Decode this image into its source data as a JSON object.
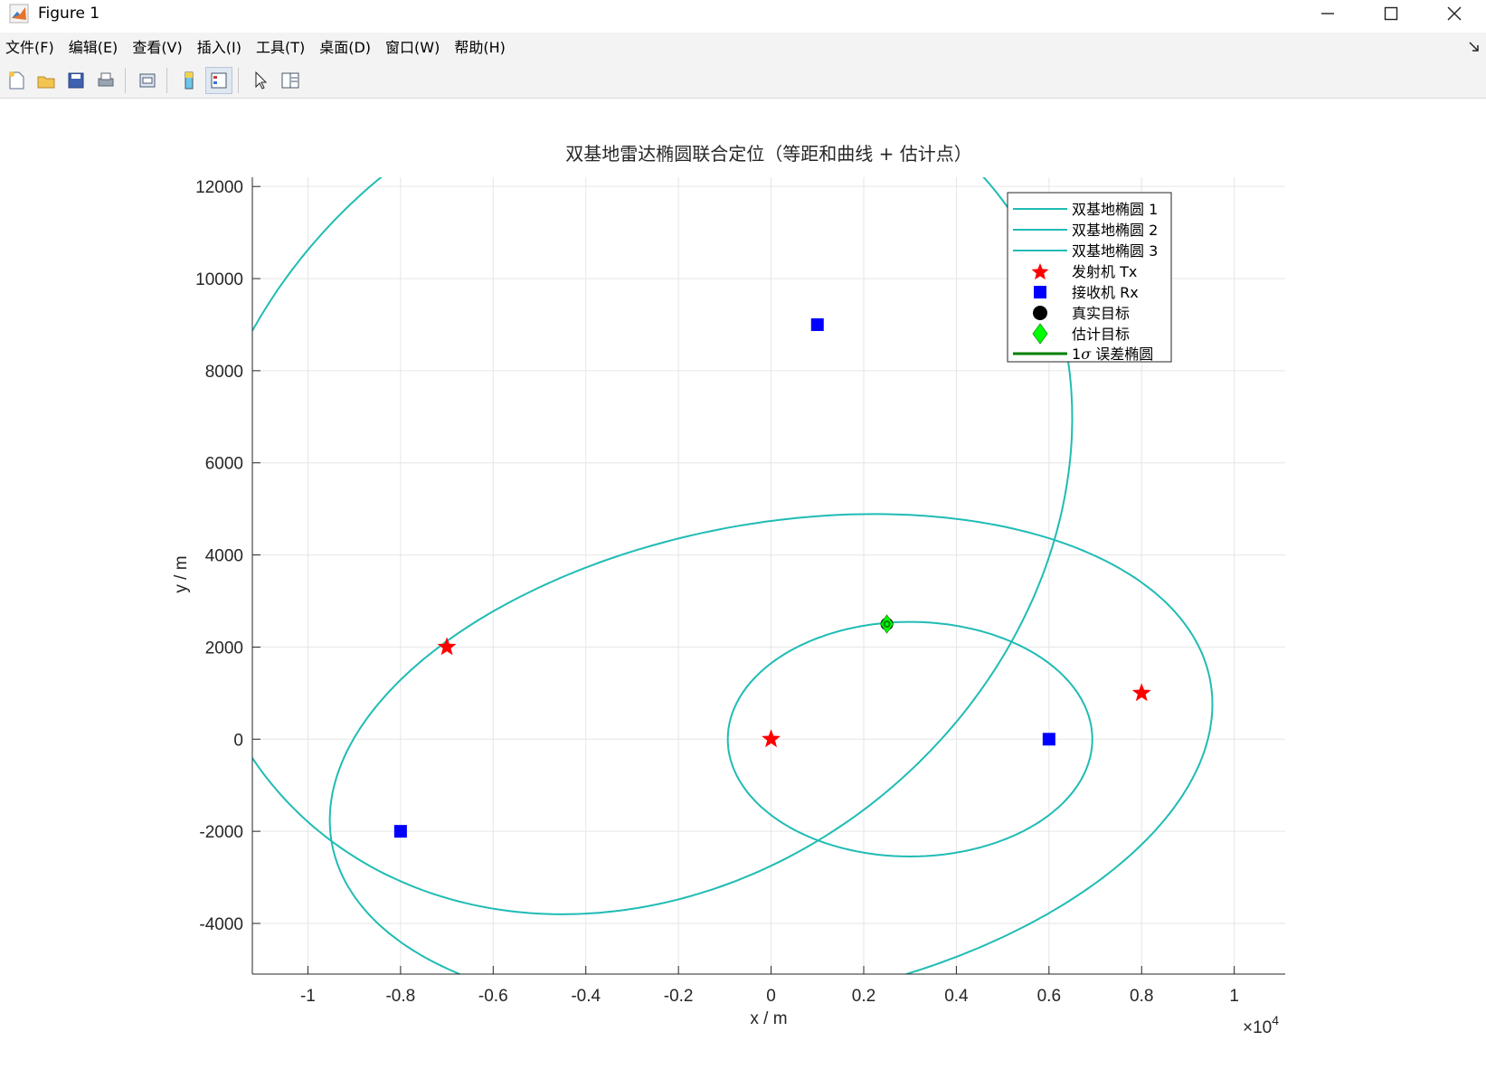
{
  "window": {
    "title": "Figure 1",
    "minimize_icon": "minimize-icon",
    "maximize_icon": "maximize-icon",
    "close_icon": "close-icon"
  },
  "menu": [
    "文件(F)",
    "编辑(E)",
    "查看(V)",
    "插入(I)",
    "工具(T)",
    "桌面(D)",
    "窗口(W)",
    "帮助(H)"
  ],
  "toolbar": {
    "icons": [
      "new-figure-icon",
      "open-file-icon",
      "save-icon",
      "print-icon",
      "link-plot-icon",
      "colorbar-icon",
      "legend-icon",
      "pointer-icon",
      "property-inspector-icon"
    ]
  },
  "colors": {
    "ellipse": "#1fbcb4",
    "tx": "#ff0000",
    "rx": "#0000ff",
    "true_target": "#000000",
    "estimate": "#00ff00",
    "error_ellipse": "#008000",
    "grid": "#e6e6e6"
  },
  "chart_data": {
    "type": "line",
    "title": "双基地雷达椭圆联合定位（等距和曲线 + 估计点）",
    "xlabel": "x / m",
    "ylabel": "y / m",
    "x_exponent_label": "×10",
    "x_exponent": "4",
    "xlim": [
      -11200,
      11100
    ],
    "ylim": [
      -5100,
      12200
    ],
    "xticks": [
      -10000,
      -8000,
      -6000,
      -4000,
      -2000,
      0,
      2000,
      4000,
      6000,
      8000,
      10000
    ],
    "xtick_labels": [
      "-1",
      "-0.8",
      "-0.6",
      "-0.4",
      "-0.2",
      "0",
      "0.2",
      "0.4",
      "0.6",
      "0.8",
      "1"
    ],
    "yticks": [
      -4000,
      -2000,
      0,
      2000,
      4000,
      6000,
      8000,
      10000,
      12000
    ],
    "ytick_labels": [
      "-4000",
      "-2000",
      "0",
      "2000",
      "4000",
      "6000",
      "8000",
      "10000",
      "12000"
    ],
    "grid": true,
    "legend_position": "top-right",
    "ellipses": [
      {
        "name": "双基地椭圆 1",
        "tx": [
          0,
          0
        ],
        "rx": [
          6000,
          0
        ],
        "sum": 7870
      },
      {
        "name": "双基地椭圆 2",
        "tx": [
          -7000,
          2000
        ],
        "rx": [
          1000,
          9000
        ],
        "sum": 20250
      },
      {
        "name": "双基地椭圆 3",
        "tx": [
          8000,
          1000
        ],
        "rx": [
          -8000,
          -2000
        ],
        "sum": 19290
      }
    ],
    "transmitters": {
      "name": "发射机 Tx",
      "x": [
        0,
        -7000,
        8000
      ],
      "y": [
        0,
        2000,
        1000
      ]
    },
    "receivers": {
      "name": "接收机 Rx",
      "x": [
        6000,
        1000,
        -8000
      ],
      "y": [
        0,
        9000,
        -2000
      ]
    },
    "true_target": {
      "name": "真实目标",
      "x": [
        2500
      ],
      "y": [
        2500
      ]
    },
    "estimate": {
      "name": "估计目标",
      "x": [
        2500
      ],
      "y": [
        2500
      ]
    },
    "error_ellipse": {
      "name_prefix": "1",
      "name_symbol": "σ",
      "name_suffix": " 误差椭圆"
    }
  }
}
